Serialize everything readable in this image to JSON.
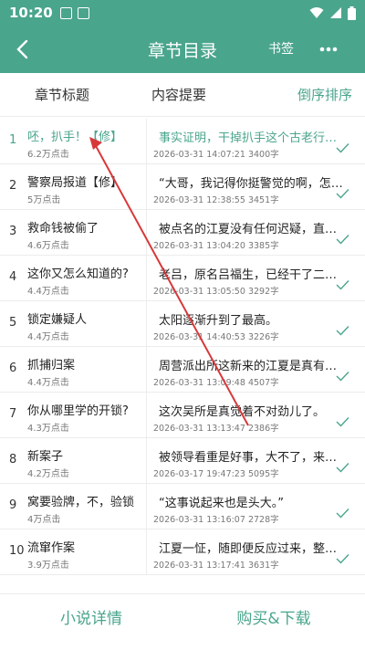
{
  "status_bar": {
    "time": "10:20"
  },
  "app_bar": {
    "title": "章节目录",
    "bookmark_label": "书签",
    "more_label": "•••"
  },
  "columns": {
    "title_header": "章节标题",
    "summary_header": "内容提要",
    "sort_label": "倒序排序"
  },
  "colors": {
    "accent": "#4aa58d",
    "arrow": "#d9383a"
  },
  "chapters": [
    {
      "num": "1",
      "title": "呸，扒手！【修】",
      "clicks": "6.2万点击",
      "summary": "事实证明，干掉扒手这个古老行…",
      "date": "2026-03-31 14:07:21",
      "words": "3400字",
      "current": true
    },
    {
      "num": "2",
      "title": "警察局报道【修】",
      "clicks": "5万点击",
      "summary": "“大哥，我记得你挺警觉的啊，怎…",
      "date": "2026-03-31 12:38:55",
      "words": "3451字",
      "current": false
    },
    {
      "num": "3",
      "title": "救命钱被偷了",
      "clicks": "4.6万点击",
      "summary": "被点名的江夏没有任何迟疑，直…",
      "date": "2026-03-31 13:04:20",
      "words": "3385字",
      "current": false
    },
    {
      "num": "4",
      "title": "这你又怎么知道的?",
      "clicks": "4.4万点击",
      "summary": "老吕，原名吕福生，已经干了二…",
      "date": "2026-03-31 13:05:50",
      "words": "3292字",
      "current": false
    },
    {
      "num": "5",
      "title": "锁定嫌疑人",
      "clicks": "4.4万点击",
      "summary": "太阳逐渐升到了最高。",
      "date": "2026-03-31 14:40:53",
      "words": "3226字",
      "current": false
    },
    {
      "num": "6",
      "title": "抓捕归案",
      "clicks": "4.4万点击",
      "summary": "周营派出所这新来的江夏是真有…",
      "date": "2026-03-31 13:09:48",
      "words": "4507字",
      "current": false
    },
    {
      "num": "7",
      "title": "你从哪里学的开锁?",
      "clicks": "4.3万点击",
      "summary": "这次吴所是真觉着不对劲儿了。",
      "date": "2026-03-31 13:13:47",
      "words": "2386字",
      "current": false
    },
    {
      "num": "8",
      "title": "新案子",
      "clicks": "4.2万点击",
      "summary": "被领导看重是好事，大不了，来…",
      "date": "2026-03-17 19:47:23",
      "words": "5095字",
      "current": false
    },
    {
      "num": "9",
      "title": "窝要验牌，不，验锁",
      "clicks": "4万点击",
      "summary": "“这事说起来也是头大。”",
      "date": "2026-03-31 13:16:07",
      "words": "2728字",
      "current": false
    },
    {
      "num": "10",
      "title": "流窜作案",
      "clicks": "3.9万点击",
      "summary": "江夏一怔，随即便反应过来，整…",
      "date": "2026-03-31 13:17:41",
      "words": "3631字",
      "current": false
    }
  ],
  "bottom": {
    "detail_label": "小说详情",
    "buy_label": "购买&下载"
  }
}
